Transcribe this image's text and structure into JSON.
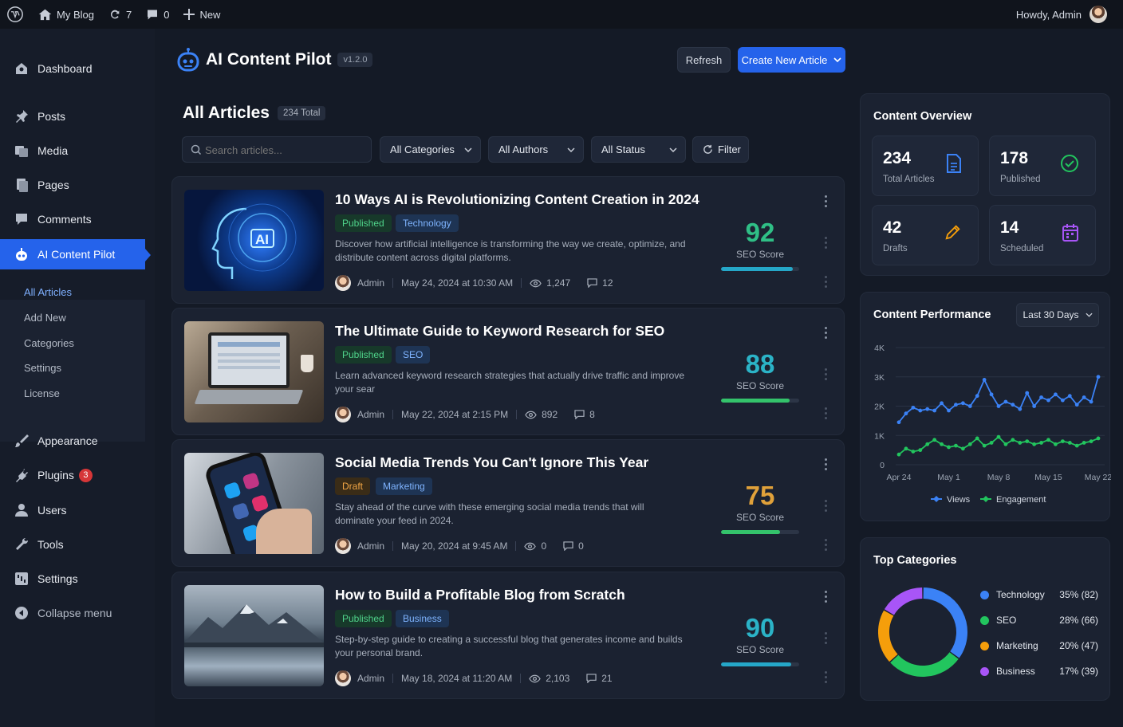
{
  "adminbar": {
    "site_name": "My Blog",
    "updates_count": "7",
    "comments_count": "0",
    "new_label": "New",
    "greeting": "Howdy, Admin"
  },
  "sidebar": {
    "items": [
      {
        "label": "Dashboard",
        "icon": "dashboard-icon"
      },
      {
        "label": "Posts",
        "icon": "pin-icon"
      },
      {
        "label": "Media",
        "icon": "media-icon"
      },
      {
        "label": "Pages",
        "icon": "pages-icon"
      },
      {
        "label": "Comments",
        "icon": "comment-icon"
      },
      {
        "label": "AI Content Pilot",
        "icon": "robot-icon"
      },
      {
        "label": "Appearance",
        "icon": "brush-icon"
      },
      {
        "label": "Plugins",
        "icon": "plug-icon",
        "badge": "3"
      },
      {
        "label": "Users",
        "icon": "user-icon"
      },
      {
        "label": "Tools",
        "icon": "wrench-icon"
      },
      {
        "label": "Settings",
        "icon": "sliders-icon"
      },
      {
        "label": "Collapse menu",
        "icon": "collapse-icon"
      }
    ],
    "submenu": [
      "All Articles",
      "Add New",
      "Categories",
      "Settings",
      "License"
    ]
  },
  "header": {
    "title": "AI Content Pilot",
    "version": "v1.2.0",
    "refresh_label": "Refresh",
    "create_label": "Create New Article"
  },
  "list": {
    "title": "All Articles",
    "total": "234 Total",
    "search_placeholder": "Search articles...",
    "filters": [
      "All Categories",
      "All Authors",
      "All Status"
    ],
    "filter_label": "Filter",
    "score_label": "SEO Score"
  },
  "articles": [
    {
      "title": "10 Ways AI is Revolutionizing Content Creation in 2024",
      "status": "Published",
      "category": "Technology",
      "excerpt": "Discover how artificial intelligence is transforming the way we create, optimize, and distribute content across digital platforms.",
      "author": "Admin",
      "date": "May 24, 2024 at 10:30 AM",
      "views": "1,247",
      "comments": "12",
      "seo_score": "92",
      "seo_value": 0.92,
      "score_color": "#2fbf86",
      "bar_color": "#25a7c8"
    },
    {
      "title": "The Ultimate Guide to Keyword Research for SEO",
      "status": "Published",
      "category": "SEO",
      "excerpt": "Learn advanced keyword research strategies that actually drive traffic and improve your sear",
      "author": "Admin",
      "date": "May 22, 2024 at 2:15 PM",
      "views": "892",
      "comments": "8",
      "seo_score": "88",
      "seo_value": 0.88,
      "score_color": "#2bb3c7",
      "bar_color": "#34c36b"
    },
    {
      "title": "Social Media Trends You Can't Ignore This Year",
      "status": "Draft",
      "category": "Marketing",
      "excerpt": "Stay ahead of the curve with these emerging social media trends that will dominate your feed in 2024.",
      "author": "Admin",
      "date": "May 20, 2024 at 9:45 AM",
      "views": "0",
      "comments": "0",
      "seo_score": "75",
      "seo_value": 0.75,
      "score_color": "#e0a13a",
      "bar_color": "#34c36b"
    },
    {
      "title": "How to Build a Profitable Blog from Scratch",
      "status": "Published",
      "category": "Business",
      "excerpt": "Step-by-step guide to creating a successful blog that generates income and builds your personal brand.",
      "author": "Admin",
      "date": "May 18, 2024 at 11:20 AM",
      "views": "2,103",
      "comments": "21",
      "seo_score": "90",
      "seo_value": 0.9,
      "score_color": "#2bb3c7",
      "bar_color": "#25a7c8"
    }
  ],
  "overview": {
    "title": "Content Overview",
    "stats": [
      {
        "value": "234",
        "label": "Total Articles",
        "icon": "document-icon",
        "color": "#3b82f6"
      },
      {
        "value": "178",
        "label": "Published",
        "icon": "check-circle-icon",
        "color": "#22c55e"
      },
      {
        "value": "42",
        "label": "Drafts",
        "icon": "pencil-icon",
        "color": "#f59e0b"
      },
      {
        "value": "14",
        "label": "Scheduled",
        "icon": "calendar-icon",
        "color": "#a855f7"
      }
    ]
  },
  "performance": {
    "title": "Content Performance",
    "range": "Last 30 Days"
  },
  "chart_data": [
    {
      "type": "line",
      "title": "Content Performance",
      "x": [
        "Apr 24",
        "Apr 25",
        "Apr 26",
        "Apr 27",
        "Apr 28",
        "Apr 29",
        "Apr 30",
        "May 1",
        "May 2",
        "May 3",
        "May 4",
        "May 5",
        "May 6",
        "May 7",
        "May 8",
        "May 9",
        "May 10",
        "May 11",
        "May 12",
        "May 13",
        "May 14",
        "May 15",
        "May 16",
        "May 17",
        "May 18",
        "May 19",
        "May 20",
        "May 21",
        "May 22"
      ],
      "x_ticks": [
        "Apr 24",
        "May 1",
        "May 8",
        "May 15",
        "May 22"
      ],
      "y_ticks": [
        "0",
        "1K",
        "2K",
        "3K",
        "4K"
      ],
      "ylim": [
        0,
        4000
      ],
      "series": [
        {
          "name": "Views",
          "color": "#3b82f6",
          "values": [
            1450,
            1750,
            1950,
            1850,
            1900,
            1850,
            2100,
            1850,
            2050,
            2100,
            2000,
            2350,
            2900,
            2400,
            2000,
            2150,
            2050,
            1900,
            2450,
            2000,
            2300,
            2200,
            2400,
            2200,
            2350,
            2050,
            2300,
            2150,
            3000
          ]
        },
        {
          "name": "Engagement",
          "color": "#22c55e",
          "values": [
            350,
            550,
            450,
            500,
            700,
            850,
            700,
            600,
            650,
            550,
            700,
            900,
            650,
            750,
            950,
            700,
            850,
            750,
            800,
            700,
            750,
            850,
            700,
            800,
            750,
            650,
            750,
            800,
            900
          ]
        }
      ],
      "legend": "bottom"
    },
    {
      "type": "pie",
      "title": "Top Categories",
      "categories": [
        "Technology",
        "SEO",
        "Marketing",
        "Business"
      ],
      "values": [
        82,
        66,
        47,
        39
      ],
      "percents": [
        "35%",
        "28%",
        "20%",
        "17%"
      ],
      "labels": [
        "35% (82)",
        "28% (66)",
        "20% (47)",
        "17% (39)"
      ],
      "colors": [
        "#3b82f6",
        "#22c55e",
        "#f59e0b",
        "#a855f7"
      ],
      "donut": true
    }
  ]
}
